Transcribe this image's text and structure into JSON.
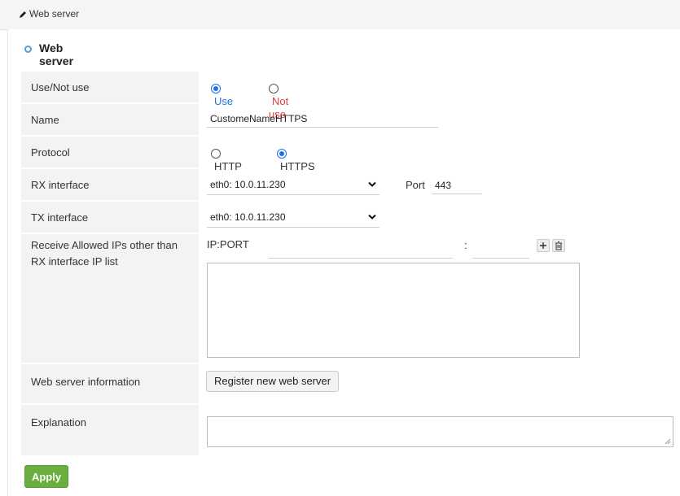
{
  "header": {
    "title": "Web server"
  },
  "section": {
    "title": "Web server"
  },
  "form": {
    "use": {
      "label": "Use/Not use",
      "opt_use": "Use",
      "opt_not_use": "Not use",
      "selected": "Use"
    },
    "name": {
      "label": "Name",
      "value": "CustomeNameHTTPS"
    },
    "protocol": {
      "label": "Protocol",
      "opt_http": "HTTP",
      "opt_https": "HTTPS",
      "selected": "HTTPS"
    },
    "rx": {
      "label": "RX interface",
      "value": "eth0: 10.0.11.230",
      "port_label": "Port",
      "port_value": "443"
    },
    "tx": {
      "label": "TX interface",
      "value": "eth0: 10.0.11.230"
    },
    "allowed": {
      "label": "Receive Allowed IPs other than RX interface IP list",
      "ip_port_label": "IP:PORT",
      "separator": ":"
    },
    "webinfo": {
      "label": "Web server information",
      "button": "Register new web server"
    },
    "explanation": {
      "label": "Explanation"
    }
  },
  "actions": {
    "apply": "Apply"
  },
  "colors": {
    "accent": "#1a73e8",
    "not_use": "#e53935",
    "apply_bg": "#6aaf3d"
  }
}
